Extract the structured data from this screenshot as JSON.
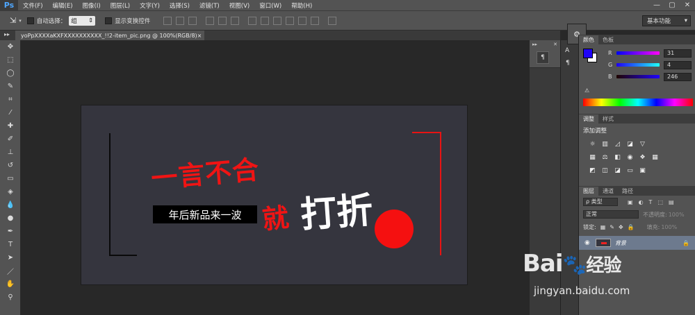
{
  "app": {
    "logo": "Ps"
  },
  "menu": [
    "文件(F)",
    "编辑(E)",
    "图像(I)",
    "图层(L)",
    "文字(Y)",
    "选择(S)",
    "滤镜(T)",
    "视图(V)",
    "窗口(W)",
    "帮助(H)"
  ],
  "window_controls": [
    "—",
    "▢",
    "✕"
  ],
  "options": {
    "auto_select_label": "自动选择：",
    "auto_select_value": "组",
    "transform_label": "显示变换控件",
    "workspace": "基本功能"
  },
  "document_tab": {
    "title": "yoPpXXXXaKXFXXXXXXXXXX_!!2-item_pic.png @ 100%(RGB/8)",
    "close": "×"
  },
  "artwork": {
    "line1": "一言不合",
    "subtitle": "年后新品来一波",
    "jiu": "就",
    "dazhe": "打折"
  },
  "color_panel": {
    "tabs": [
      "颜色",
      "色板"
    ],
    "r_label": "R",
    "r_value": "31",
    "g_label": "G",
    "g_value": "4",
    "b_label": "B",
    "b_value": "246",
    "foreground": "#1f04f6"
  },
  "adjust_panel": {
    "tabs": [
      "调整",
      "样式"
    ],
    "title": "添加调整"
  },
  "layers_panel": {
    "tabs": [
      "图层",
      "通道",
      "路径"
    ],
    "kind": "ρ 类型",
    "blend": "正常",
    "opacity_label": "不透明度:",
    "opacity_value": "100%",
    "lock_label": "锁定:",
    "fill_label": "填充:",
    "fill_value": "100%",
    "layer_name": "背景"
  },
  "watermark": {
    "brand": "Bai",
    "brand2": "经验",
    "url": "jingyan.baidu.com"
  }
}
